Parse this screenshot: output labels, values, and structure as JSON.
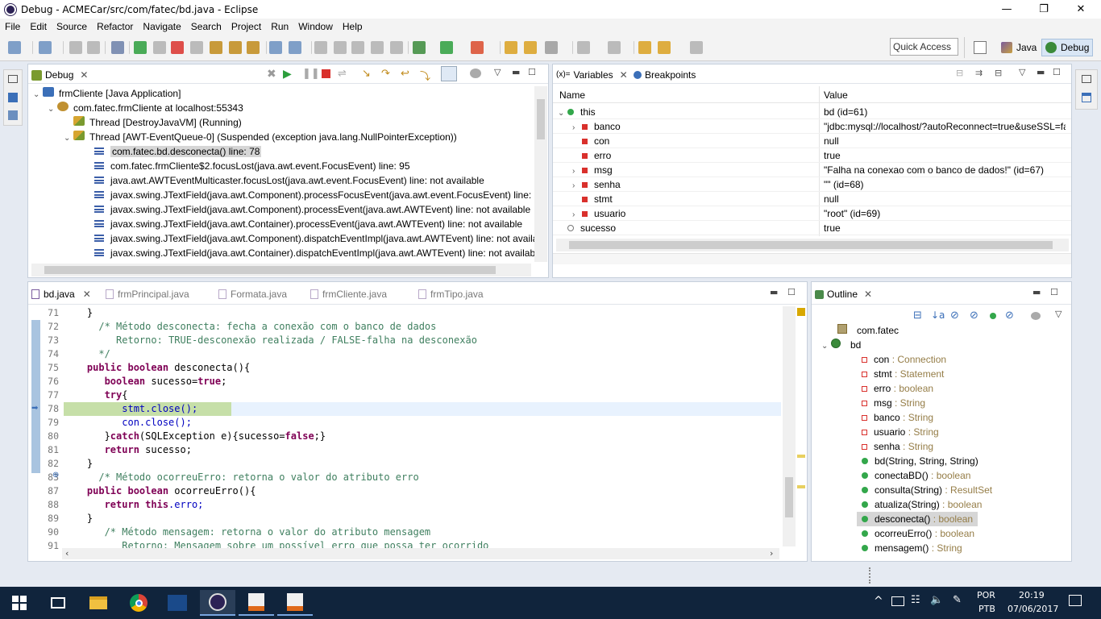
{
  "window": {
    "title": "Debug - ACMECar/src/com/fatec/bd.java - Eclipse",
    "minimize": "—",
    "maximize": "❐",
    "close": "✕"
  },
  "menu": [
    "File",
    "Edit",
    "Source",
    "Refactor",
    "Navigate",
    "Search",
    "Project",
    "Run",
    "Window",
    "Help"
  ],
  "quick_access": "Quick Access",
  "perspectives": {
    "java": "Java",
    "debug": "Debug"
  },
  "debug_view": {
    "tab": "Debug",
    "tree": [
      {
        "label": "frmCliente [Java Application]",
        "level": 0
      },
      {
        "label": "com.fatec.frmCliente at localhost:55343",
        "level": 1
      },
      {
        "label": "Thread [DestroyJavaVM] (Running)",
        "level": 2
      },
      {
        "label": "Thread [AWT-EventQueue-0] (Suspended (exception java.lang.NullPointerException))",
        "level": 2
      },
      {
        "label": "com.fatec.bd.desconecta() line: 78",
        "level": 3
      },
      {
        "label": "com.fatec.frmCliente$2.focusLost(java.awt.event.FocusEvent) line: 95",
        "level": 3
      },
      {
        "label": "java.awt.AWTEventMulticaster.focusLost(java.awt.event.FocusEvent) line: not available",
        "level": 3
      },
      {
        "label": "javax.swing.JTextField(java.awt.Component).processFocusEvent(java.awt.event.FocusEvent) line: no",
        "level": 3
      },
      {
        "label": "javax.swing.JTextField(java.awt.Component).processEvent(java.awt.AWTEvent) line: not available",
        "level": 3
      },
      {
        "label": "javax.swing.JTextField(java.awt.Container).processEvent(java.awt.AWTEvent) line: not available",
        "level": 3
      },
      {
        "label": "javax.swing.JTextField(java.awt.Component).dispatchEventImpl(java.awt.AWTEvent) line: not availat",
        "level": 3
      },
      {
        "label": "javax.swing.JTextField(java.awt.Container).dispatchEventImpl(java.awt.AWTEvent) line: not availab",
        "level": 3
      }
    ]
  },
  "variables_view": {
    "tab": "Variables",
    "tab_prefix": "(x)=",
    "breakpoints_tab": "Breakpoints",
    "col_name": "Name",
    "col_value": "Value",
    "rows": [
      {
        "name": "this",
        "value": "bd  (id=61)"
      },
      {
        "name": "banco",
        "value": "\"jdbc:mysql://localhost/?autoReconnect=true&useSSL=fa"
      },
      {
        "name": "con",
        "value": "null"
      },
      {
        "name": "erro",
        "value": "true"
      },
      {
        "name": "msg",
        "value": "\"Falha na conexao com o banco de dados!\" (id=67)"
      },
      {
        "name": "senha",
        "value": "\"\" (id=68)"
      },
      {
        "name": "stmt",
        "value": "null"
      },
      {
        "name": "usuario",
        "value": "\"root\" (id=69)"
      },
      {
        "name": "sucesso",
        "value": "true"
      }
    ]
  },
  "editor": {
    "tabs": [
      "bd.java",
      "frmPrincipal.java",
      "Formata.java",
      "frmCliente.java",
      "frmTipo.java"
    ],
    "lines": [
      {
        "n": "71",
        "html": "    }"
      },
      {
        "n": "72",
        "c": "      /* Método desconecta: fecha a conexão com o banco de dados"
      },
      {
        "n": "73",
        "c": "         Retorno: TRUE-desconexão realizada / FALSE-falha na desconexão"
      },
      {
        "n": "74",
        "c": "      */"
      },
      {
        "n": "75",
        "k": "    public boolean",
        "t": " desconecta(){"
      },
      {
        "n": "76",
        "k": "       boolean",
        "t": " sucesso=",
        "k2": "true",
        "t2": ";"
      },
      {
        "n": "77",
        "k": "       try",
        "t": "{"
      },
      {
        "n": "78",
        "t": "          stmt.close();"
      },
      {
        "n": "79",
        "t": "          con.close();"
      },
      {
        "n": "80",
        "t": "       }",
        "k": "catch",
        "t2": "(SQLException e){sucesso=",
        "k2": "false",
        "t3": ";}"
      },
      {
        "n": "81",
        "k": "       return",
        "t": " sucesso;"
      },
      {
        "n": "82",
        "t": "    }"
      },
      {
        "n": "83",
        "c": "      /* Método ocorreuErro: retorna o valor do atributo erro"
      },
      {
        "n": "87",
        "k": "    public boolean",
        "t": " ocorreuErro(){"
      },
      {
        "n": "88",
        "k": "       return this",
        "t": ".erro;"
      },
      {
        "n": "89",
        "t": "    }"
      },
      {
        "n": "90",
        "c": "       /* Método mensagem: retorna o valor do atributo mensagem"
      },
      {
        "n": "91",
        "c": "          Retorno: Mensagem sobre um possível erro que possa ter ocorrido"
      }
    ]
  },
  "outline": {
    "tab": "Outline",
    "package": "com.fatec",
    "class": "bd",
    "members": [
      {
        "name": "con",
        "type": " : Connection",
        "kind": "field"
      },
      {
        "name": "stmt",
        "type": " : Statement",
        "kind": "field"
      },
      {
        "name": "erro",
        "type": " : boolean",
        "kind": "field"
      },
      {
        "name": "msg",
        "type": " : String",
        "kind": "field"
      },
      {
        "name": "banco",
        "type": " : String",
        "kind": "field"
      },
      {
        "name": "usuario",
        "type": " : String",
        "kind": "field"
      },
      {
        "name": "senha",
        "type": " : String",
        "kind": "field"
      },
      {
        "name": "bd(String, String, String)",
        "type": "",
        "kind": "ctor"
      },
      {
        "name": "conectaBD()",
        "type": " : boolean",
        "kind": "method"
      },
      {
        "name": "consulta(String)",
        "type": " : ResultSet",
        "kind": "method"
      },
      {
        "name": "atualiza(String)",
        "type": " : boolean",
        "kind": "method"
      },
      {
        "name": "desconecta()",
        "type": " : boolean",
        "kind": "method"
      },
      {
        "name": "ocorreuErro()",
        "type": " : boolean",
        "kind": "method"
      },
      {
        "name": "mensagem()",
        "type": " : String",
        "kind": "method"
      }
    ]
  },
  "taskbar": {
    "lang1": "POR",
    "lang2": "PTB",
    "time": "20:19",
    "date": "07/06/2017"
  }
}
